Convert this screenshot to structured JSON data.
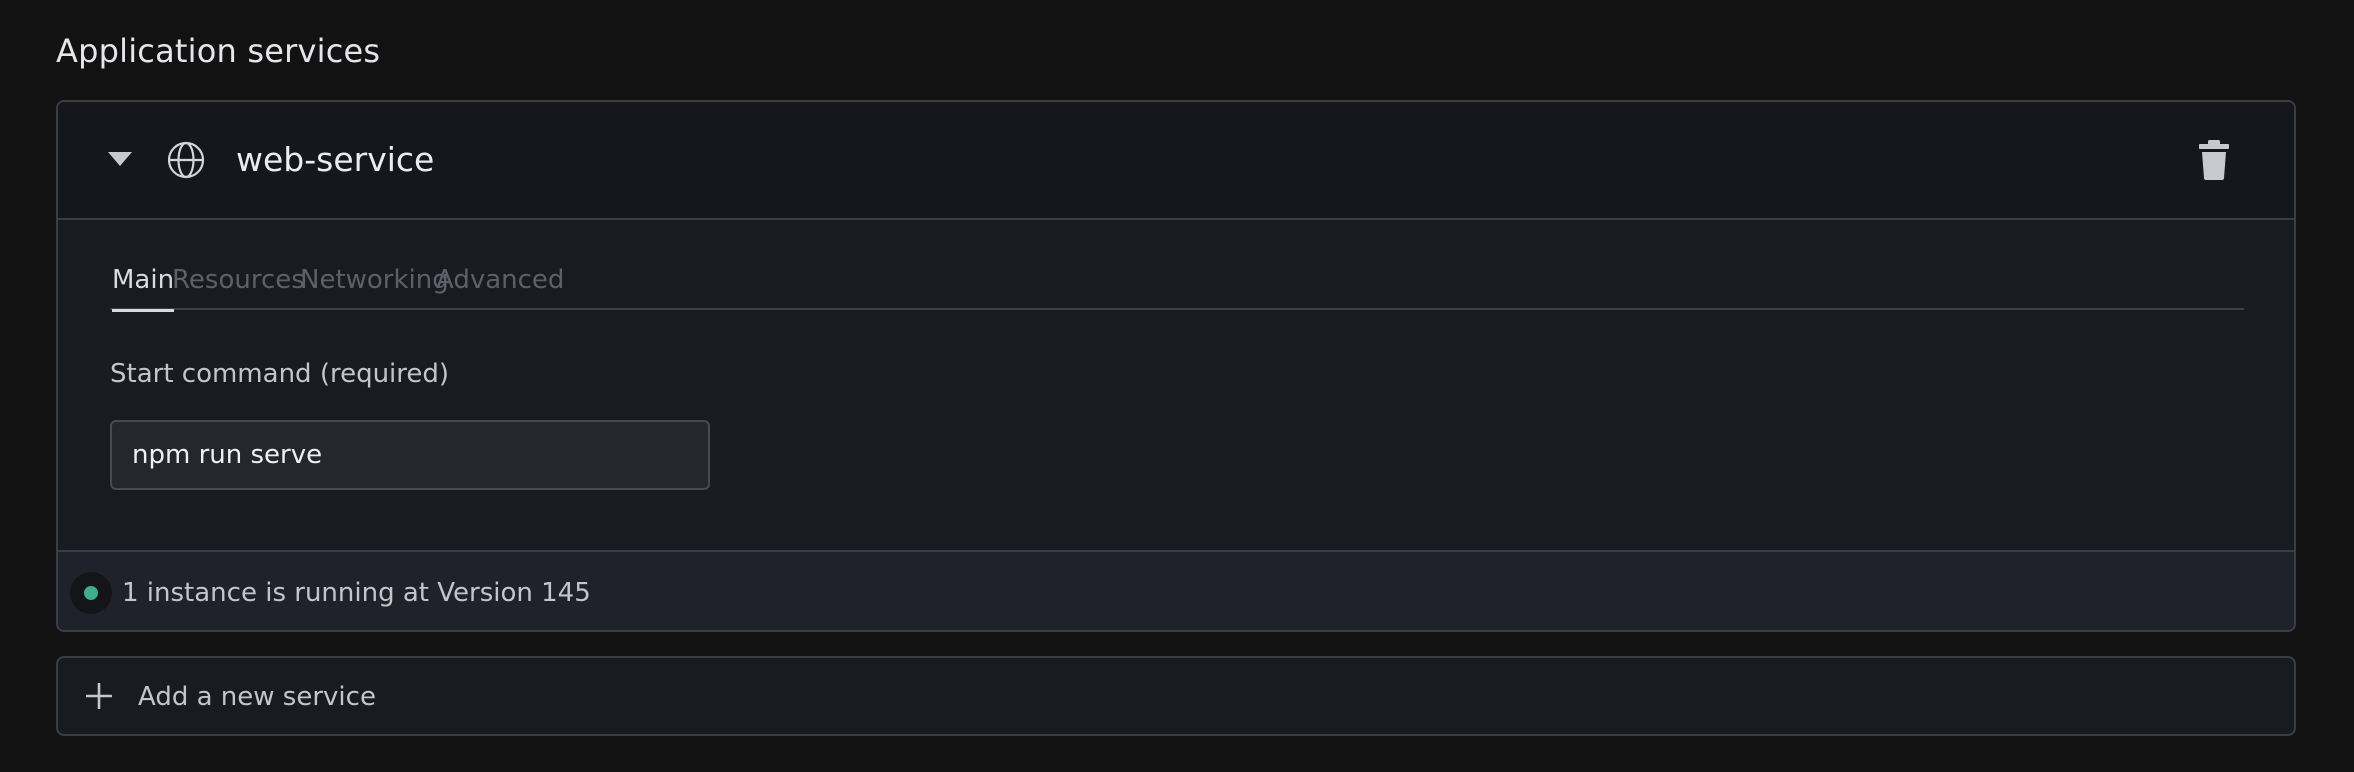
{
  "section_title": "Application services",
  "service": {
    "name": "web-service",
    "icons": {
      "toggle": "caret-down-icon",
      "type": "globe-icon",
      "delete": "trash-icon"
    },
    "tabs": [
      {
        "label": "Main",
        "active": true
      },
      {
        "label": "Resources",
        "active": false
      },
      {
        "label": "Networking",
        "active": false
      },
      {
        "label": "Advanced",
        "active": false
      }
    ],
    "start_command": {
      "label": "Start command (required)",
      "value": "npm run serve"
    },
    "status": {
      "text": "1 instance is running at Version 145",
      "color": "#3fae8c"
    }
  },
  "add_service": {
    "label": "Add a new service",
    "icon": "plus-icon"
  }
}
